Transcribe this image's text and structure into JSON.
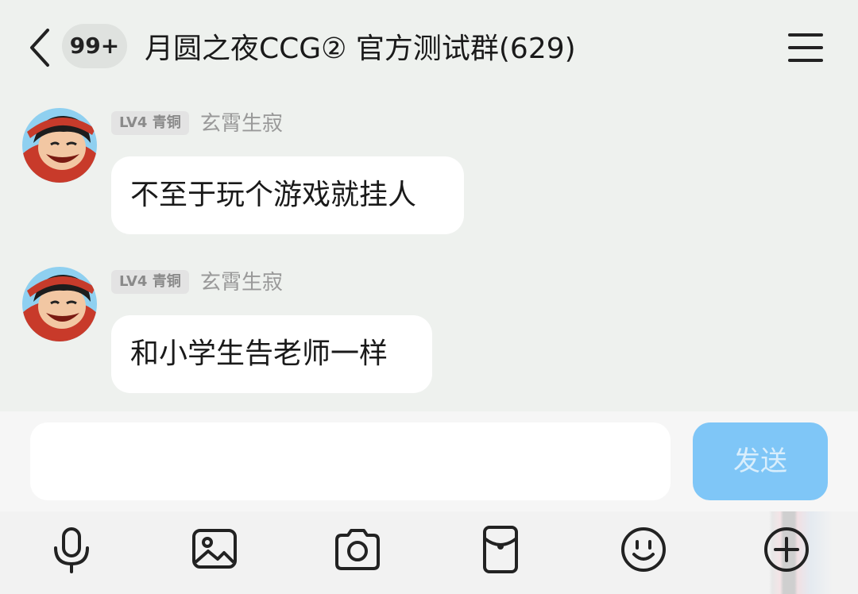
{
  "header": {
    "unread_count": "99+",
    "title": "月圆之夜CCG② 官方测试群(629)",
    "back_icon": "chevron-left-icon",
    "menu_icon": "hamburger-menu-icon"
  },
  "messages": [
    {
      "sender": "玄霄生寂",
      "level_badge": "LV4 青铜",
      "text": "不至于玩个游戏就挂人",
      "avatar": "avatar-image"
    },
    {
      "sender": "玄霄生寂",
      "level_badge": "LV4 青铜",
      "text": "和小学生告老师一样",
      "avatar": "avatar-image"
    }
  ],
  "input": {
    "value": "",
    "placeholder": "",
    "send_label": "发送"
  },
  "toolbar": {
    "icons": [
      "microphone-icon",
      "image-icon",
      "camera-icon",
      "red-packet-icon",
      "emoji-icon",
      "plus-icon"
    ]
  },
  "colors": {
    "background": "#eef1ee",
    "bubble": "#ffffff",
    "send_button": "#7fc6f7",
    "send_text": "#d9eefc",
    "level_badge_bg": "#e3e3e3",
    "sender_name": "#999999"
  }
}
